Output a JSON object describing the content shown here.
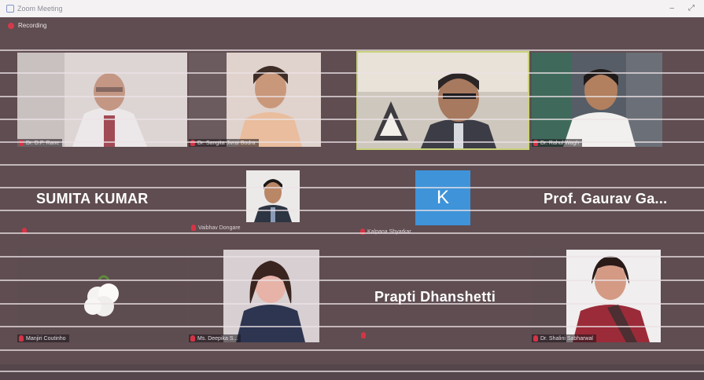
{
  "window": {
    "title": "Zoom Meeting",
    "controls": [
      "–",
      "⤢"
    ]
  },
  "recording": {
    "label": "Recording"
  },
  "colors": {
    "stage": "#5f4d51",
    "active_border": "#c8d37a",
    "avatar_k": "#3f93d9",
    "muted": "#d53446"
  },
  "participants": [
    {
      "name": "Dr. D.P. Rane",
      "kind": "video",
      "muted": true
    },
    {
      "name": "Dr. Sangita Jivrai Bodra",
      "kind": "video",
      "muted": true
    },
    {
      "name": "",
      "kind": "video",
      "active_speaker": true
    },
    {
      "name": "Dr. Rahul Wagh",
      "kind": "video",
      "muted": true
    },
    {
      "name": "SUMITA KUMAR",
      "kind": "name"
    },
    {
      "name": "Vaibhav Dongare",
      "kind": "video",
      "muted": true
    },
    {
      "name": "Kalpana Shyarkar",
      "kind": "avatar",
      "avatar_letter": "K",
      "muted": true
    },
    {
      "name": "Prof. Gaurav Ga...",
      "kind": "name"
    },
    {
      "name": "Manjiri Coutinho",
      "kind": "video",
      "muted": true
    },
    {
      "name": "Ms. Deepika S...",
      "kind": "video",
      "muted": true
    },
    {
      "name": "Prapti Dhanshetti",
      "kind": "name"
    },
    {
      "name": "Dr. Shalini Sabharwal",
      "kind": "video",
      "muted": true
    }
  ]
}
